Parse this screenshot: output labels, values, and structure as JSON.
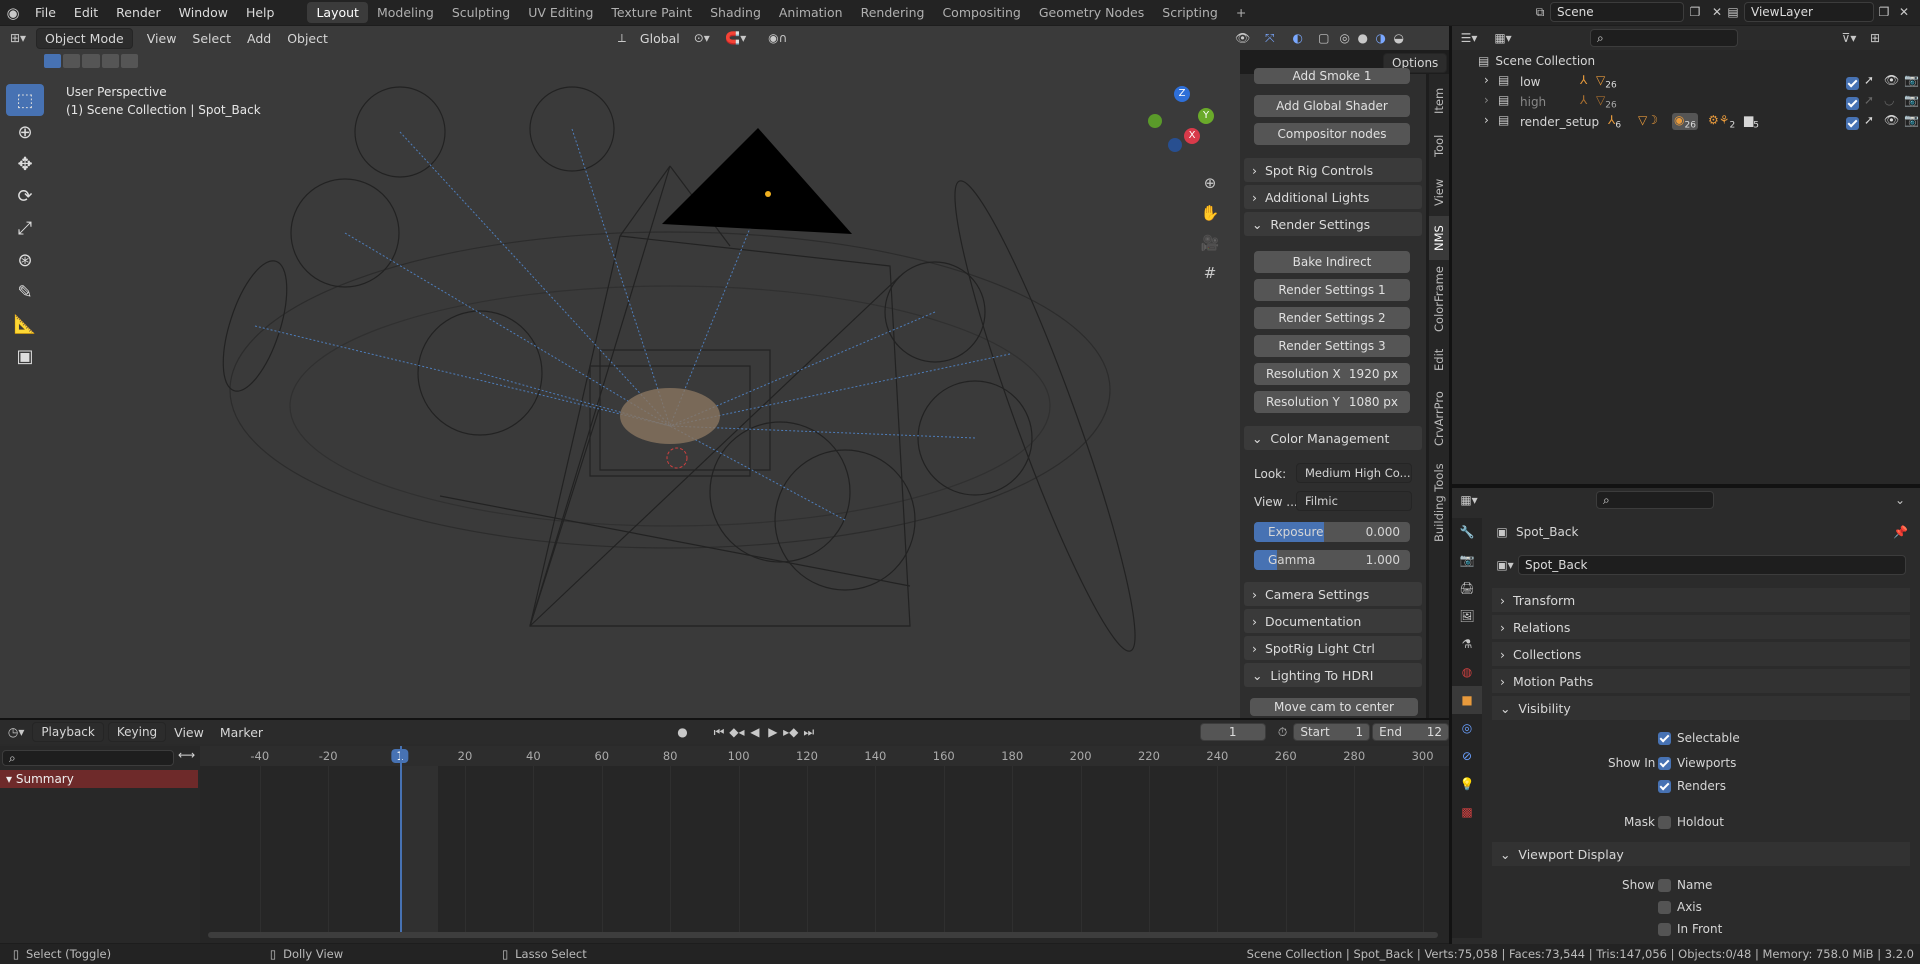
{
  "topbar": {
    "menus": [
      "File",
      "Edit",
      "Render",
      "Window",
      "Help"
    ],
    "workspaces": [
      "Layout",
      "Modeling",
      "Sculpting",
      "UV Editing",
      "Texture Paint",
      "Shading",
      "Animation",
      "Rendering",
      "Compositing",
      "Geometry Nodes",
      "Scripting"
    ],
    "active_workspace": "Layout",
    "add_workspace": "+",
    "scene": "Scene",
    "view_layer": "ViewLayer"
  },
  "viewport_header": {
    "mode": "Object Mode",
    "menus": [
      "View",
      "Select",
      "Add",
      "Object"
    ],
    "orientation": "Global",
    "options": "Options"
  },
  "viewport": {
    "perspective": "User Perspective",
    "context": "(1) Scene Collection | Spot_Back",
    "gizmo_axes": [
      "X",
      "Y",
      "Z"
    ]
  },
  "npanel": {
    "buttons_top": [
      "Add Smoke 1",
      "Add Global Shader",
      "Compositor nodes"
    ],
    "sections": [
      "Spot Rig Controls",
      "Additional Lights",
      "Render Settings"
    ],
    "render_buttons": [
      "Bake Indirect",
      "Render Settings 1",
      "Render Settings 2",
      "Render Settings 3"
    ],
    "resolution_x_label": "Resolution X",
    "resolution_x": "1920 px",
    "resolution_y_label": "Resolution Y",
    "resolution_y": "1080 px",
    "color_management": "Color Management",
    "look_label": "Look:",
    "look_value": "Medium High Co...",
    "view_label": "View ...",
    "view_value": "Filmic",
    "exposure_label": "Exposure",
    "exposure_value": "0.000",
    "exposure_fill": 0.45,
    "gamma_label": "Gamma",
    "gamma_value": "1.000",
    "gamma_fill": 0.15,
    "sections_bottom": [
      "Camera Settings",
      "Documentation",
      "SpotRig Light Ctrl",
      "Lighting To HDRI"
    ],
    "move_cam": "Move cam to center",
    "tabs": [
      "Item",
      "Tool",
      "View",
      "NMS",
      "ColorFrame",
      "Edit",
      "CrvArrPro",
      "Building Tools"
    ]
  },
  "outliner": {
    "search_placeholder": "",
    "root": "Scene Collection",
    "items": [
      {
        "name": "low",
        "badge1": "26"
      },
      {
        "name": "high",
        "badge1": "26"
      },
      {
        "name": "render_setup",
        "badge1": "6",
        "badge2": "26",
        "badge3": "2",
        "badge4": "5"
      }
    ]
  },
  "properties": {
    "object_name": "Spot_Back",
    "data_name": "Spot_Back",
    "panels": [
      "Transform",
      "Relations",
      "Collections",
      "Motion Paths",
      "Visibility"
    ],
    "selectable": "Selectable",
    "show_in": "Show In",
    "viewports": "Viewports",
    "renders": "Renders",
    "mask": "Mask",
    "holdout": "Holdout",
    "viewport_display": "Viewport Display",
    "show": "Show",
    "name": "Name",
    "axis": "Axis",
    "in_front": "In Front"
  },
  "timeline": {
    "menus": [
      "Playback",
      "Keying",
      "View",
      "Marker"
    ],
    "current_frame": "1",
    "start_label": "Start",
    "start": "1",
    "end_label": "End",
    "end": "12",
    "ruler": [
      "-40",
      "-20",
      "1",
      "20",
      "40",
      "60",
      "80",
      "100",
      "120",
      "140",
      "160",
      "180",
      "200",
      "220",
      "240",
      "260",
      "280",
      "300"
    ],
    "summary": "Summary"
  },
  "statusbar": {
    "select": "Select (Toggle)",
    "dolly": "Dolly View",
    "lasso": "Lasso Select",
    "stats": "Scene Collection | Spot_Back | Verts:75,058 | Faces:73,544 | Tris:147,056 | Objects:0/48 | Memory: 758.0 MiB | 3.2.0"
  },
  "colors": {
    "accent": "#4772b3",
    "active_frame": "#4772b3",
    "summary_bg": "#6e2a2a"
  }
}
